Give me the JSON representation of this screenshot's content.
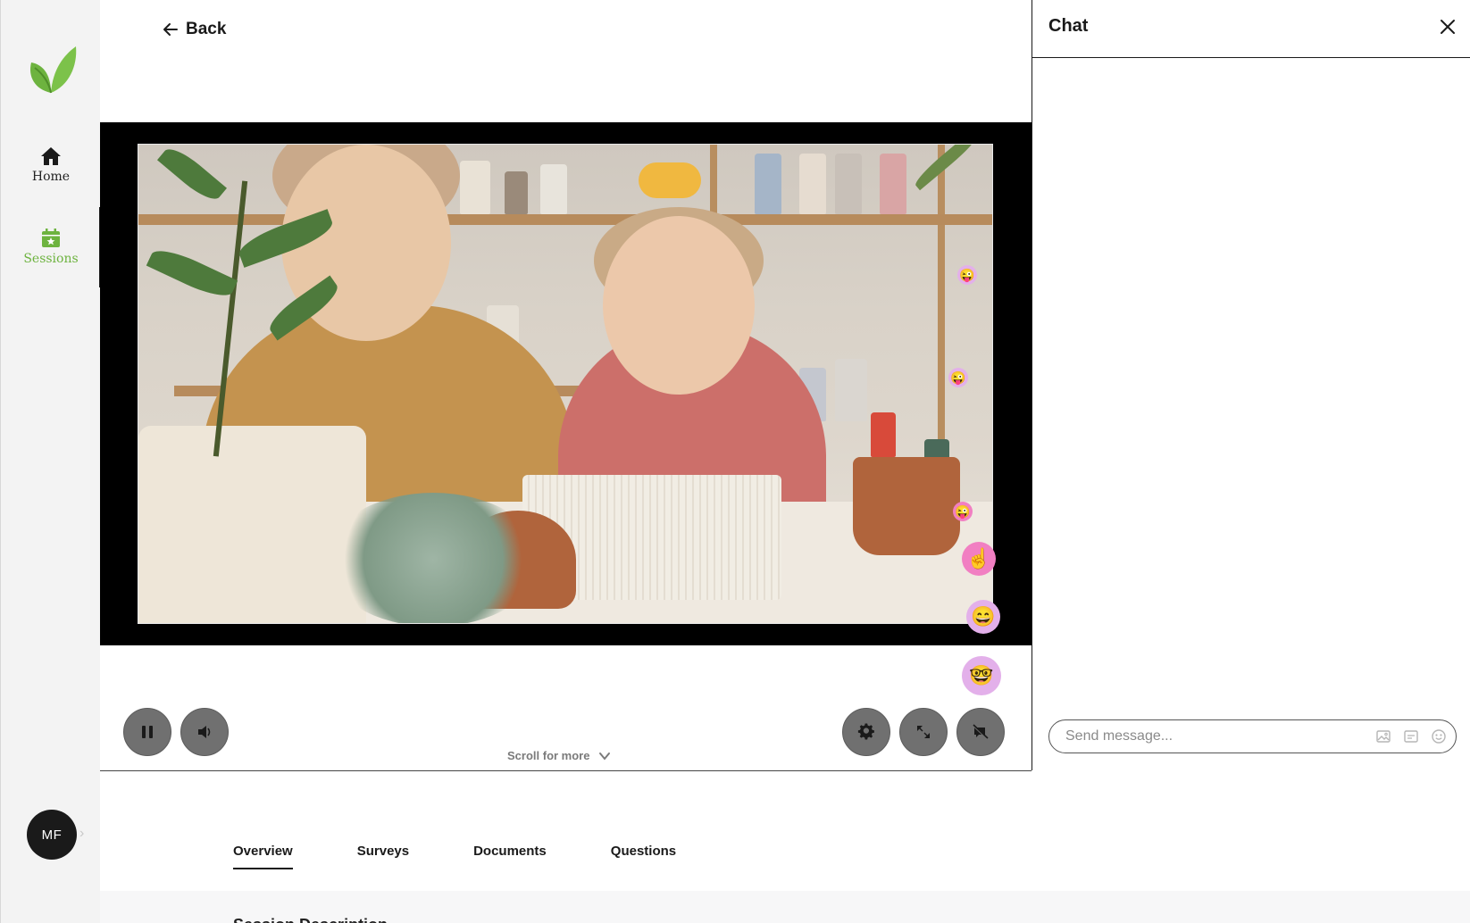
{
  "sidebar": {
    "logo_icon": "leaf-logo-icon",
    "items": [
      {
        "label": "Home",
        "icon": "home-icon"
      },
      {
        "label": "Sessions",
        "icon": "calendar-star-icon"
      }
    ],
    "avatar_initials": "MF"
  },
  "header": {
    "back_label": "Back"
  },
  "video": {
    "scroll_hint": "Scroll for more"
  },
  "tabs": [
    {
      "label": "Overview",
      "active": true
    },
    {
      "label": "Surveys",
      "active": false
    },
    {
      "label": "Documents",
      "active": false
    },
    {
      "label": "Questions",
      "active": false
    }
  ],
  "section": {
    "heading": "Session Description"
  },
  "chat": {
    "title": "Chat",
    "input_placeholder": "Send message..."
  },
  "colors": {
    "brand_green": "#6db33f",
    "dark": "#1a1a1a",
    "control_gray": "#707070"
  }
}
